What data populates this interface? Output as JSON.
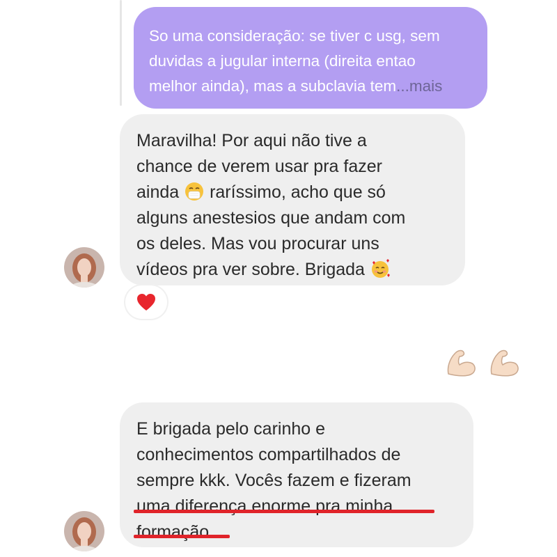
{
  "conversation": {
    "quoted_message": {
      "text": "So uma consideração: se tiver c usg, sem\nduvidas a jugular interna (direita entao\nmelhor ainda), mas a subclavia tem",
      "more_label": "...mais"
    },
    "messages": [
      {
        "line1": "Maravilha! Por aqui não tive a\nchance de verem usar pra fazer\nainda ",
        "emoji1": "sneezing-face-emoji",
        "line2": " raríssimo, acho que só\nalguns anestesios que andam com\nos deles. Mas vou procurar uns\nvídeos pra ver sobre. Brigada ",
        "emoji2": "smiling-face-with-hearts-emoji",
        "reaction": "red-heart"
      },
      {
        "text_plain": "E brigada pelo carinho e\nconhecimentos compartilhados de\nsempre kkk. Vocês fazem e fizeram\n",
        "text_underlined": "uma diferença enorme pra minha\nformação"
      }
    ],
    "sent_emojis": [
      "flexed-biceps",
      "flexed-biceps"
    ]
  },
  "colors": {
    "outgoing_bubble": "#b39ef2",
    "incoming_bubble": "#efefef",
    "underline": "#e0242a",
    "reaction_heart": "#e8262d"
  }
}
